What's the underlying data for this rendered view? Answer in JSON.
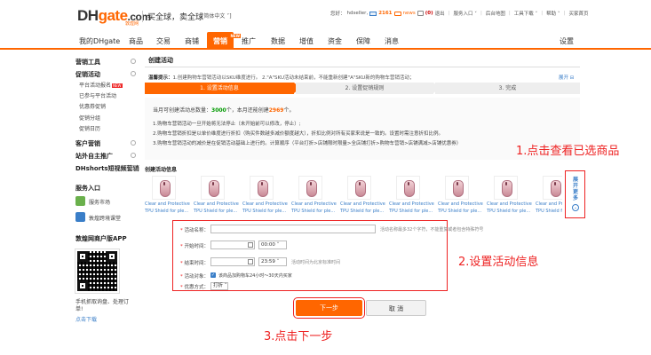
{
  "header": {
    "logo_dh": "DH",
    "logo_gate": "gate",
    "logo_com": ".com",
    "logo_sub": "敦煌网",
    "slogan": "买全球，卖全球",
    "lang": "[简体中文 ˅]",
    "greeting": "您好：",
    "username": "hdseller,",
    "mail_count": "2161",
    "news_label": "news",
    "msg_count": "0",
    "logout": "退出",
    "service": "服务入口 ˅",
    "backend": "后台地图",
    "toolbox": "工具下载 ˅",
    "help": "帮助 ˅",
    "homepage": "买家首页"
  },
  "nav": {
    "items": [
      "我的DHgate",
      "商品",
      "交易",
      "商铺",
      "营销",
      "推广",
      "数据",
      "增值",
      "资金",
      "保障",
      "消息"
    ],
    "active_new": "NEW",
    "settings": "设置"
  },
  "sidebar": {
    "groups": [
      {
        "title": "营销工具",
        "toggle": "⊟"
      },
      {
        "title": "促销活动",
        "toggle": "⊟"
      },
      {
        "title": "客户营销",
        "toggle": "⊞"
      },
      {
        "title": "站外自主推广",
        "toggle": "⊞"
      },
      {
        "title": "DHshorts短视频营销",
        "toggle": "⊞"
      }
    ],
    "promo_items": [
      "平台活动报名",
      "已参与平台活动",
      "优惠券促销",
      "促销分组",
      "促销日历"
    ],
    "new_badge": "NEW",
    "service_title": "服务入口",
    "service_market": "服务市场",
    "service_class": "敦煌跨境课堂",
    "app_title": "敦煌网商户版APP",
    "app_desc": "手机抓取询盘、处理订单!",
    "app_download": "点击下载"
  },
  "main": {
    "section_title": "创建活动",
    "tip_label": "温馨提示：",
    "tip_text": "1.创建购物车营销活动以SKU维度进行。  2.\"A\"SKU活动未结束前，不能重新创建\"A\"SKU新的购物车营销活动；",
    "expand": "展开 ⊟",
    "steps": [
      "1. 设置活动信息",
      "2. 设置促销规则",
      "3. 完成"
    ],
    "count_prefix": "当月可创建活动总数量：",
    "count_total": "3000",
    "count_mid": "个，本月还能创建",
    "count_remain": "2969",
    "count_suffix": "个。",
    "rules": [
      "1.购物车营销活动一旦开始将无法停止（未开始前可以修改，停止）;",
      "2.购物车营销折扣是以单价维度进行折扣（购买件数越多减价额度越大），折扣比例对所有买家来说是一致的。设置时需注意折扣比例。",
      "3.购物车营销活动的减价是在促销活动基础上进行的。计算顺序（平台打折>店铺限时限量>全店铺打折>购物车营销>店铺满减>店铺优惠券）"
    ],
    "product_title": "创建活动信息",
    "product_caption_1": "Clear and Protective",
    "product_caption_2": "TPU Shield for ple...",
    "expand_more": "展开更多",
    "expand_more_icon": "⌄"
  },
  "form": {
    "req": "*",
    "name_label": "活动名称：",
    "name_hint": "活动名称最多32个字符，不能重复或者包含特殊符号",
    "start_label": "开始时间：",
    "start_time": "00:00 ˅",
    "end_label": "结束时间：",
    "end_time": "23:59 ˅",
    "end_hint": "活动时间为北京标准时间",
    "target_label": "活动对象：",
    "target_text": "该商品加购物车24小时～30天内买家",
    "discount_label": "优惠方式：",
    "discount_value": "打折 ˅"
  },
  "buttons": {
    "next": "下一步",
    "cancel": "取 消"
  },
  "annotations": {
    "a1": "1.点击查看已选商品",
    "a2": "2.设置活动信息",
    "a3": "3.点击下一步"
  },
  "colors": {
    "brand": "#ff6600",
    "annotation": "#ee2222",
    "link": "#3a7ec8"
  }
}
